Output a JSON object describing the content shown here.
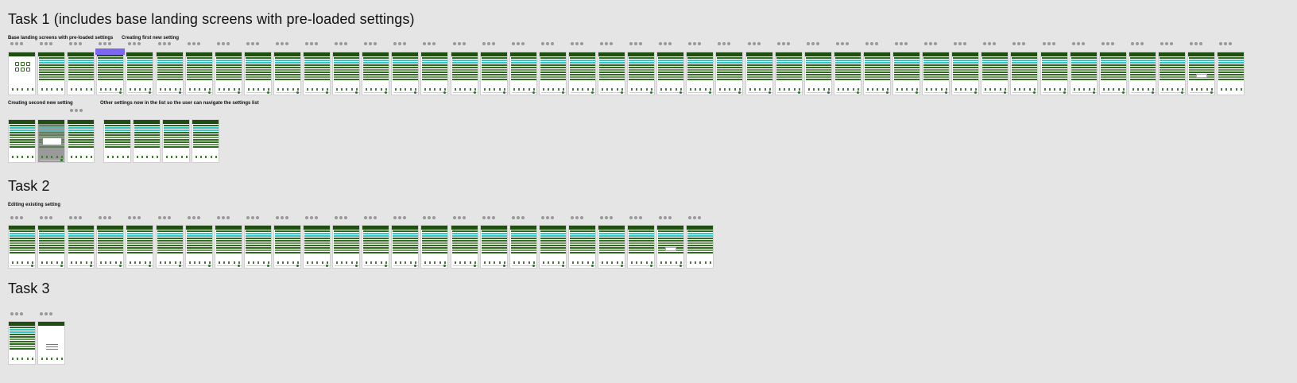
{
  "tasks": [
    {
      "title": "Task 1 (includes base landing screens with pre-loaded settings)",
      "sections": [
        {
          "label": "Base landing screens with pre-loaded settings"
        },
        {
          "label": "Creating first new setting"
        },
        {
          "label": "Creating second new setting"
        },
        {
          "label": "Other settings now in the list so the user can navigate the settings list"
        }
      ]
    },
    {
      "title": "Task 2",
      "sections": [
        {
          "label": "Editing existing setting"
        }
      ]
    },
    {
      "title": "Task 3",
      "sections": []
    }
  ],
  "colors": {
    "canvas_bg": "#e5e5e5",
    "header_green": "#1f4d12",
    "row_green": "#2f6b1f",
    "highlight_cyan": "#37c6c6",
    "selection_purple": "#7b68ee"
  },
  "icons": {
    "frame_menu": "more-dots-icon"
  }
}
